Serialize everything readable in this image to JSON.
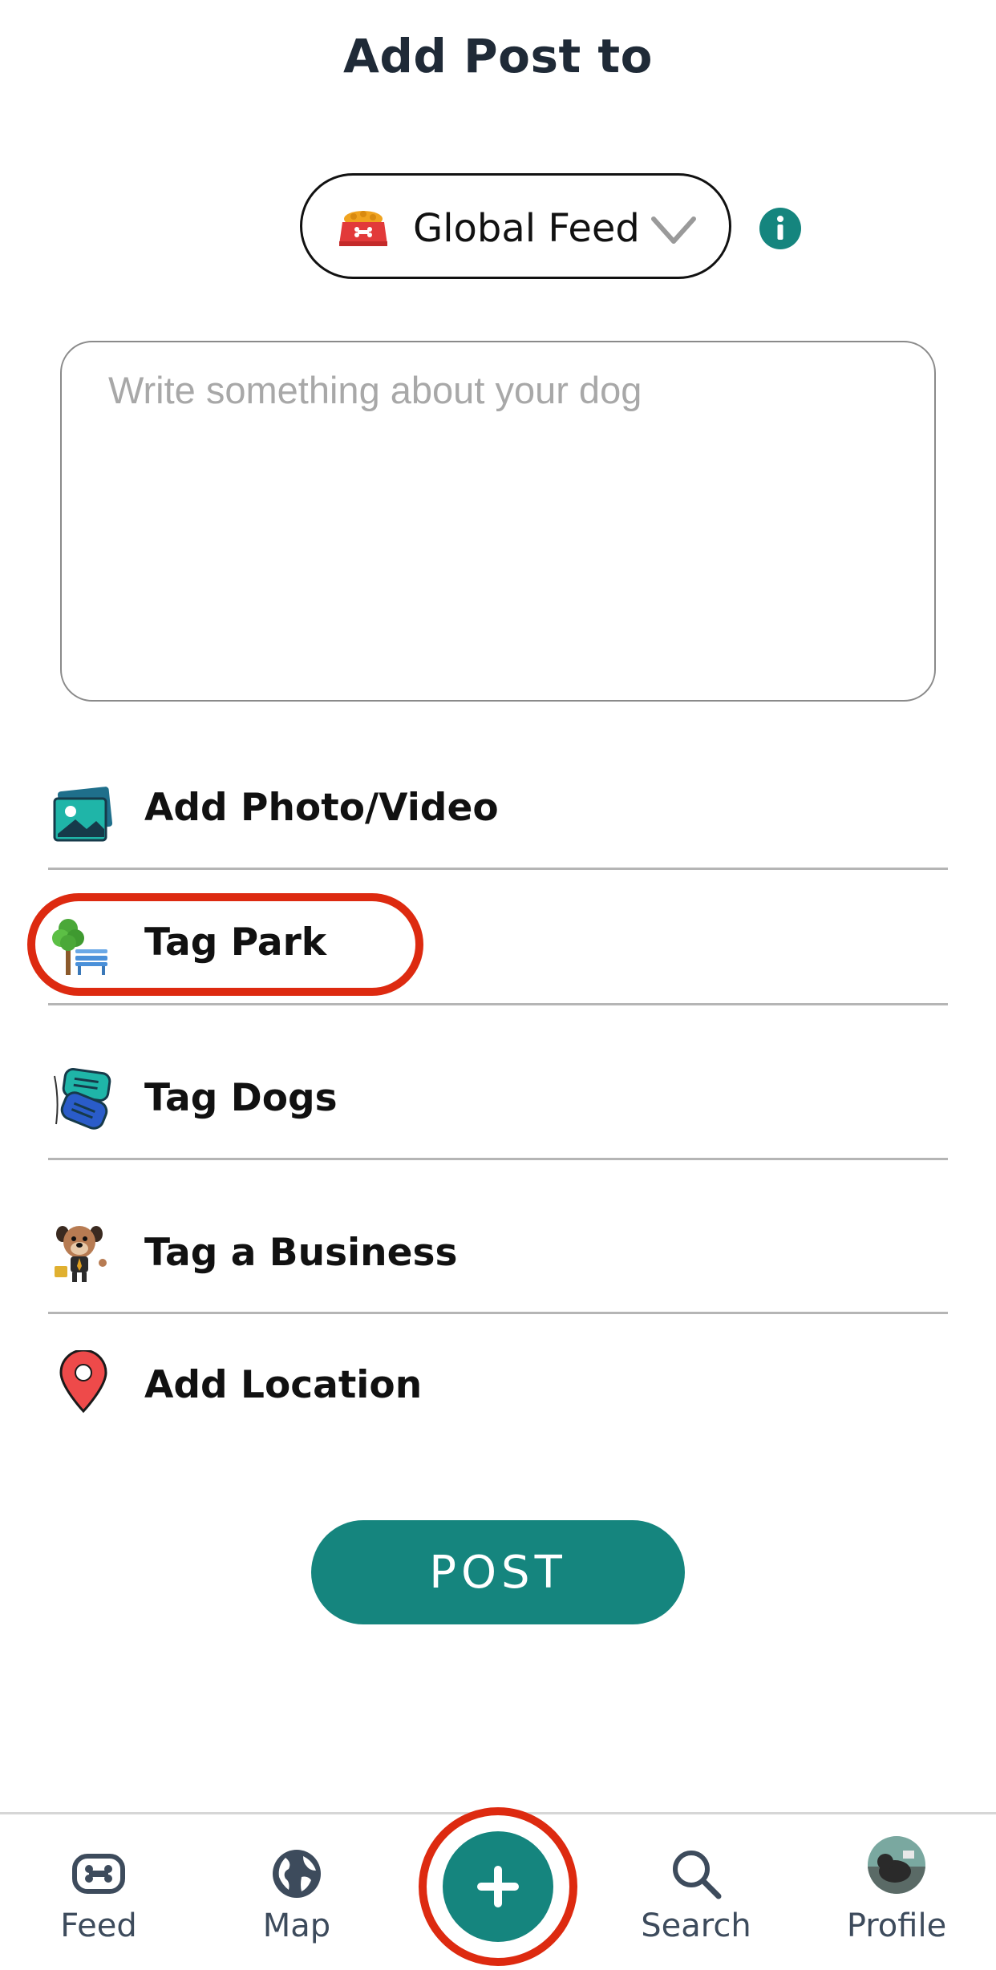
{
  "header": {
    "title": "Add Post to"
  },
  "feed_selector": {
    "selected": "Global Feed",
    "icon": "dog-bowl-icon"
  },
  "composer": {
    "placeholder": "Write something about your dog",
    "value": ""
  },
  "options": [
    {
      "label": "Add Photo/Video",
      "icon": "photo-video-icon"
    },
    {
      "label": "Tag Park",
      "icon": "park-tree-icon"
    },
    {
      "label": "Tag Dogs",
      "icon": "dog-tags-icon"
    },
    {
      "label": "Tag a Business",
      "icon": "business-dog-icon"
    },
    {
      "label": "Add Location",
      "icon": "location-pin-icon"
    }
  ],
  "post_button": {
    "label": "POST"
  },
  "bottom_nav": {
    "items": [
      {
        "label": "Feed",
        "icon": "feed-bone-icon"
      },
      {
        "label": "Map",
        "icon": "globe-icon"
      },
      {
        "label": "",
        "icon": "add-post-plus-icon"
      },
      {
        "label": "Search",
        "icon": "search-icon"
      },
      {
        "label": "Profile",
        "icon": "avatar"
      }
    ]
  },
  "colors": {
    "accent": "#15857e",
    "highlight": "#dd2a10",
    "title": "#1f2a37",
    "nav_label": "#3d4b5c"
  }
}
